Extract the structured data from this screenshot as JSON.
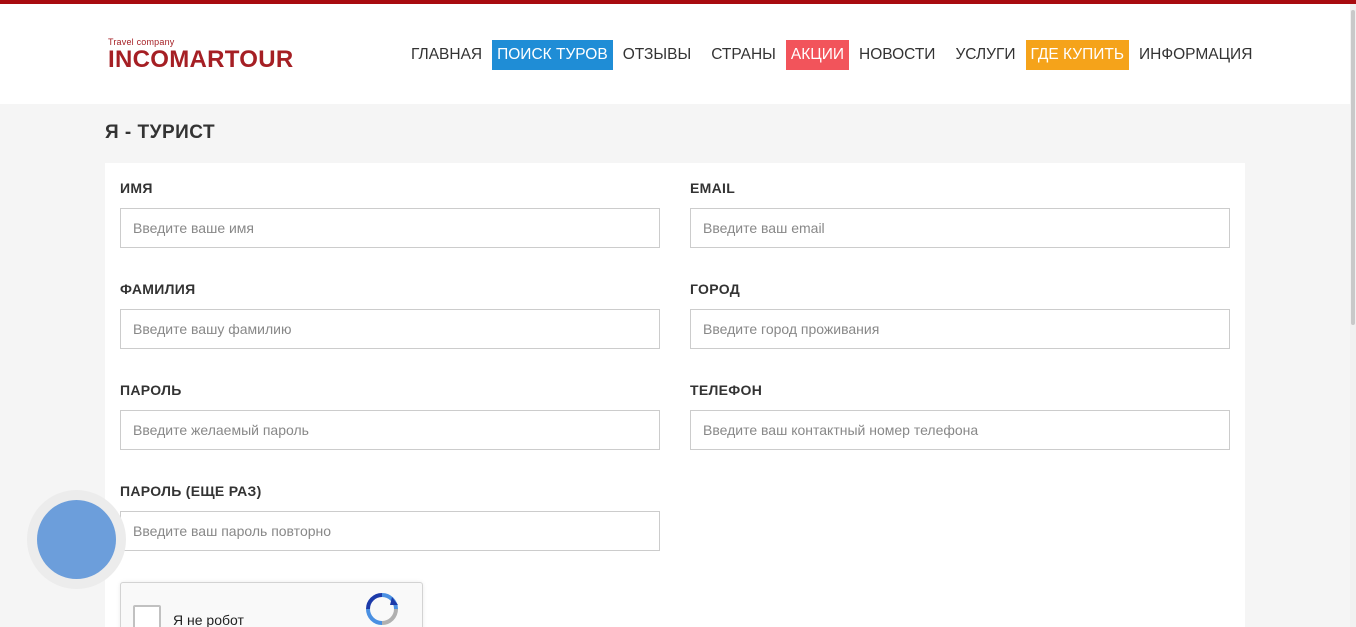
{
  "logo": {
    "tagline": "Travel company",
    "name": "INCOMARTOUR"
  },
  "nav": {
    "items": [
      {
        "label": "ГЛАВНАЯ"
      },
      {
        "label": "ПОИСК ТУРОВ"
      },
      {
        "label": "ОТЗЫВЫ"
      },
      {
        "label": "СТРАНЫ"
      },
      {
        "label": "АКЦИИ"
      },
      {
        "label": "НОВОСТИ"
      },
      {
        "label": "УСЛУГИ"
      },
      {
        "label": "ГДЕ КУПИТЬ"
      },
      {
        "label": "ИНФОРМАЦИЯ"
      }
    ]
  },
  "page": {
    "title": "Я - ТУРИСТ"
  },
  "form": {
    "name": {
      "label": "ИМЯ",
      "placeholder": "Введите ваше имя"
    },
    "email": {
      "label": "EMAIL",
      "placeholder": "Введите ваш email"
    },
    "surname": {
      "label": "ФАМИЛИЯ",
      "placeholder": "Введите вашу фамилию"
    },
    "city": {
      "label": "ГОРОД",
      "placeholder": "Введите город проживания"
    },
    "password": {
      "label": "ПАРОЛЬ",
      "placeholder": "Введите желаемый пароль"
    },
    "phone": {
      "label": "ТЕЛЕФОН",
      "placeholder": "Введите ваш контактный номер телефона"
    },
    "password_repeat": {
      "label": "ПАРОЛЬ (ЕЩЕ РАЗ)",
      "placeholder": "Введите ваш пароль повторно"
    }
  },
  "captcha": {
    "label": "Я не робот",
    "icon": "recaptcha-icon"
  },
  "chat": {
    "icon": "chat-widget-icon"
  },
  "colors": {
    "brand": "#a51f24",
    "nav_blue": "#1f8dd6",
    "nav_red": "#f2545b",
    "nav_orange": "#f5a31a"
  }
}
